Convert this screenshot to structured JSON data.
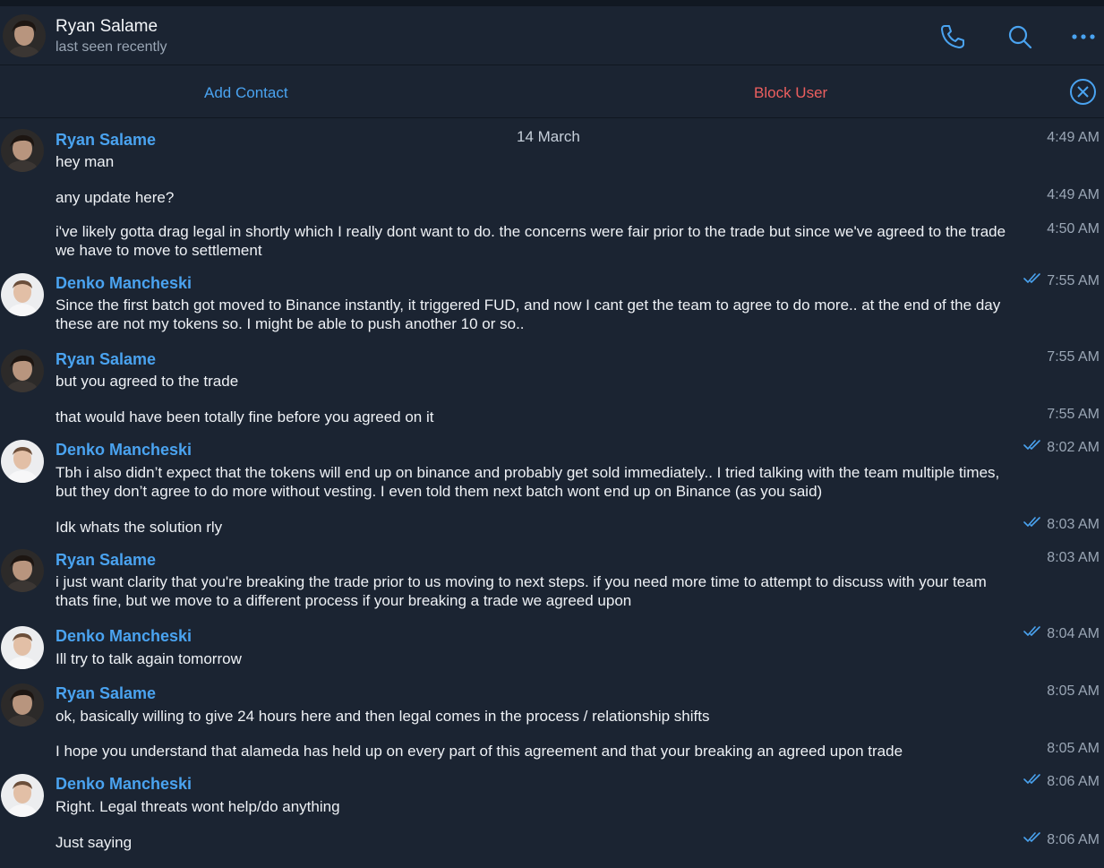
{
  "header": {
    "name": "Ryan Salame",
    "status": "last seen recently",
    "icons": [
      "phone-icon",
      "search-icon",
      "more-icon"
    ]
  },
  "actions": {
    "add_contact": "Add Contact",
    "block_user": "Block User"
  },
  "date_separator": "14 March",
  "colors": {
    "background": "#1b2432",
    "accent": "#4aa3f0",
    "danger": "#ec5f5f",
    "muted": "#9aa6b5"
  },
  "messages": [
    {
      "sender": "Ryan Salame",
      "text": "hey man",
      "time": "4:49 AM"
    },
    {
      "text": "any update here?",
      "time": "4:49 AM"
    },
    {
      "text": "i've likely gotta drag legal in shortly which I really dont want to do. the concerns were fair prior to the trade but since we've agreed to the trade we have to move to settlement",
      "time": "4:50 AM"
    },
    {
      "sender": "Denko Mancheski",
      "text": "Since the first batch got moved to Binance instantly, it triggered FUD, and now I cant get the team to agree to do more.. at the end of the day these are not my tokens so. I might be able to push another 10 or so..",
      "time": "7:55 AM",
      "read": true
    },
    {
      "sender": "Ryan Salame",
      "text": "but you agreed to the trade",
      "time": "7:55 AM"
    },
    {
      "text": "that would have been totally fine before you agreed on it",
      "time": "7:55 AM"
    },
    {
      "sender": "Denko Mancheski",
      "text": "Tbh i also didn’t expect that the tokens will end up on binance and probably get sold immediately.. I tried talking with the team multiple times, but they don’t agree to do more without vesting. I even told them next batch wont end up on Binance (as you said)",
      "time": "8:02 AM",
      "read": true
    },
    {
      "text": "Idk whats the solution rly",
      "time": "8:03 AM",
      "read": true
    },
    {
      "sender": "Ryan Salame",
      "text": "i just want clarity that you're breaking the trade prior to us moving to next steps. if you need more time to attempt to discuss with your team thats fine, but we move to a different process if your breaking a trade we agreed upon",
      "time": "8:03 AM"
    },
    {
      "sender": "Denko Mancheski",
      "text": "Ill try to talk again tomorrow",
      "time": "8:04 AM",
      "read": true
    },
    {
      "sender": "Ryan Salame",
      "text": "ok, basically willing to give 24 hours here and then legal comes in the process / relationship shifts",
      "time": "8:05 AM"
    },
    {
      "text": "I hope you understand that alameda has held up on every part of this agreement and that your breaking an agreed upon trade",
      "time": "8:05 AM"
    },
    {
      "sender": "Denko Mancheski",
      "text": "Right. Legal threats wont help/do anything",
      "time": "8:06 AM",
      "read": true
    },
    {
      "text": "Just saying",
      "time": "8:06 AM",
      "read": true
    }
  ]
}
